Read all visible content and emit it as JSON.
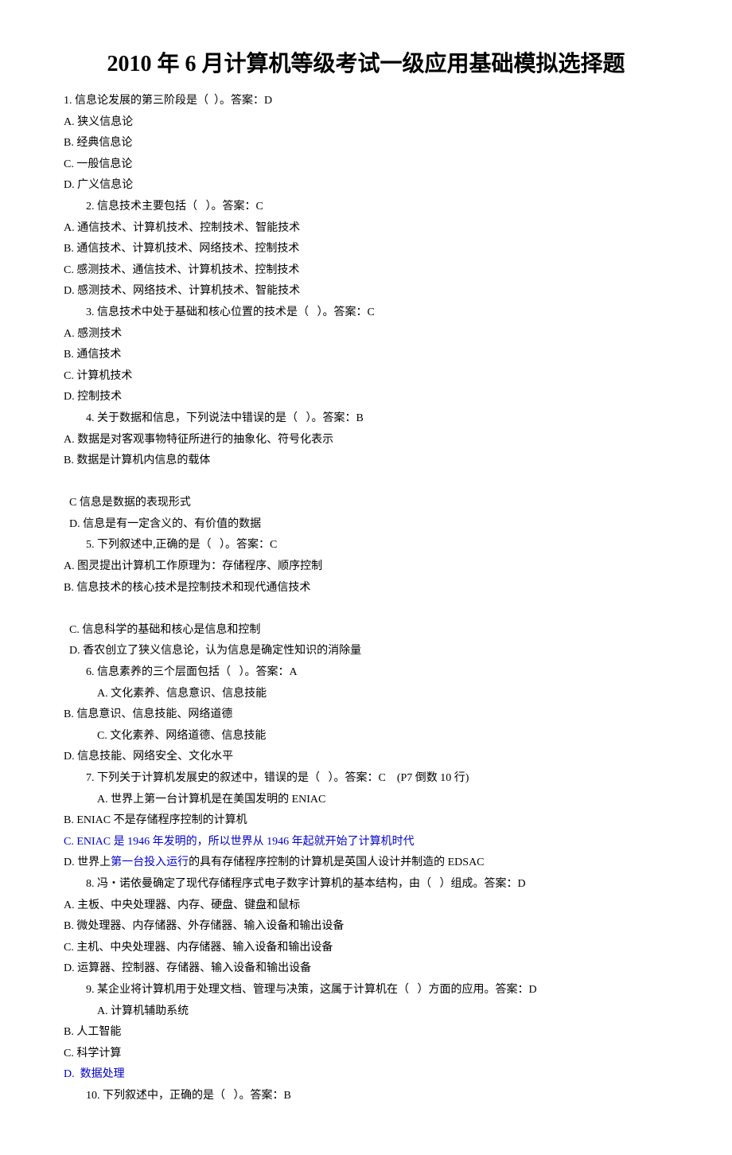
{
  "title": "2010 年 6 月计算机等级考试一级应用基础模拟选择题",
  "lines": {
    "l1": "1. 信息论发展的第三阶段是（  ）。答案：D",
    "l2": "A. 狭义信息论",
    "l3": "B. 经典信息论",
    "l4": "C. 一般信息论",
    "l5": "D. 广义信息论",
    "l6": "2. 信息技术主要包括（   ）。答案：C",
    "l7": "A. 通信技术、计算机技术、控制技术、智能技术",
    "l8": "B. 通信技术、计算机技术、网络技术、控制技术",
    "l9": "C. 感测技术、通信技术、计算机技术、控制技术",
    "l10": "D. 感测技术、网络技术、计算机技术、智能技术",
    "l11": "3. 信息技术中处于基础和核心位置的技术是（   ）。答案：C",
    "l12": "A. 感测技术",
    "l13": "B. 通信技术",
    "l14": "C. 计算机技术",
    "l15": "D. 控制技术",
    "l16": "4. 关于数据和信息，下列说法中错误的是（   ）。答案：B",
    "l17": "A. 数据是对客观事物特征所进行的抽象化、符号化表示",
    "l18": "B. 数据是计算机内信息的载体",
    "l19a": "C 信息是数据的表现形式",
    "l19b": "D. 信息是有一定含义的、有价值的数据",
    "l20": "5. 下列叙述中,正确的是（   ）。答案：C",
    "l21": "A. 图灵提出计算机工作原理为：存储程序、顺序控制",
    "l22": "B. 信息技术的核心技术是控制技术和现代通信技术",
    "l23a": "C. 信息科学的基础和核心是信息和控制",
    "l23b": "D. 香农创立了狭义信息论，认为信息是确定性知识的消除量",
    "l24": "6. 信息素养的三个层面包括（   ）。答案：A",
    "l25": "A. 文化素养、信息意识、信息技能",
    "l26": "B. 信息意识、信息技能、网络道德",
    "l27": "C. 文化素养、网络道德、信息技能",
    "l28": "D. 信息技能、网络安全、文化水平",
    "l29": "7. 下列关于计算机发展史的叙述中，错误的是（   ）。答案：C    (P7 倒数 10 行)",
    "l30": "A. 世界上第一台计算机是在美国发明的 ENIAC",
    "l31": "B. ENIAC 不是存储程序控制的计算机",
    "l32": "C. ENIAC 是 1946 年发明的，所以世界从 1946 年起就开始了计算机时代",
    "l33a": "D. 世界上",
    "l33b": "第一台投入运行",
    "l33c": "的具有存储程序控制的计算机是英国人设计并制造的 EDSAC",
    "l34": "8. 冯・诺依曼确定了现代存储程序式电子数字计算机的基本结构，由（   ）组成。答案：D",
    "l35": "A. 主板、中央处理器、内存、硬盘、键盘和鼠标",
    "l36": "B. 微处理器、内存储器、外存储器、输入设备和输出设备",
    "l37": "C. 主机、中央处理器、内存储器、输入设备和输出设备",
    "l38": "D. 运算器、控制器、存储器、输入设备和输出设备",
    "l39": "9. 某企业将计算机用于处理文档、管理与决策，这属于计算机在（   ）方面的应用。答案：D",
    "l40": "A. 计算机辅助系统",
    "l41": "B. 人工智能",
    "l42": "C. 科学计算",
    "l43": "D.  数据处理",
    "l44": "10. 下列叙述中，正确的是（   ）。答案：B"
  }
}
